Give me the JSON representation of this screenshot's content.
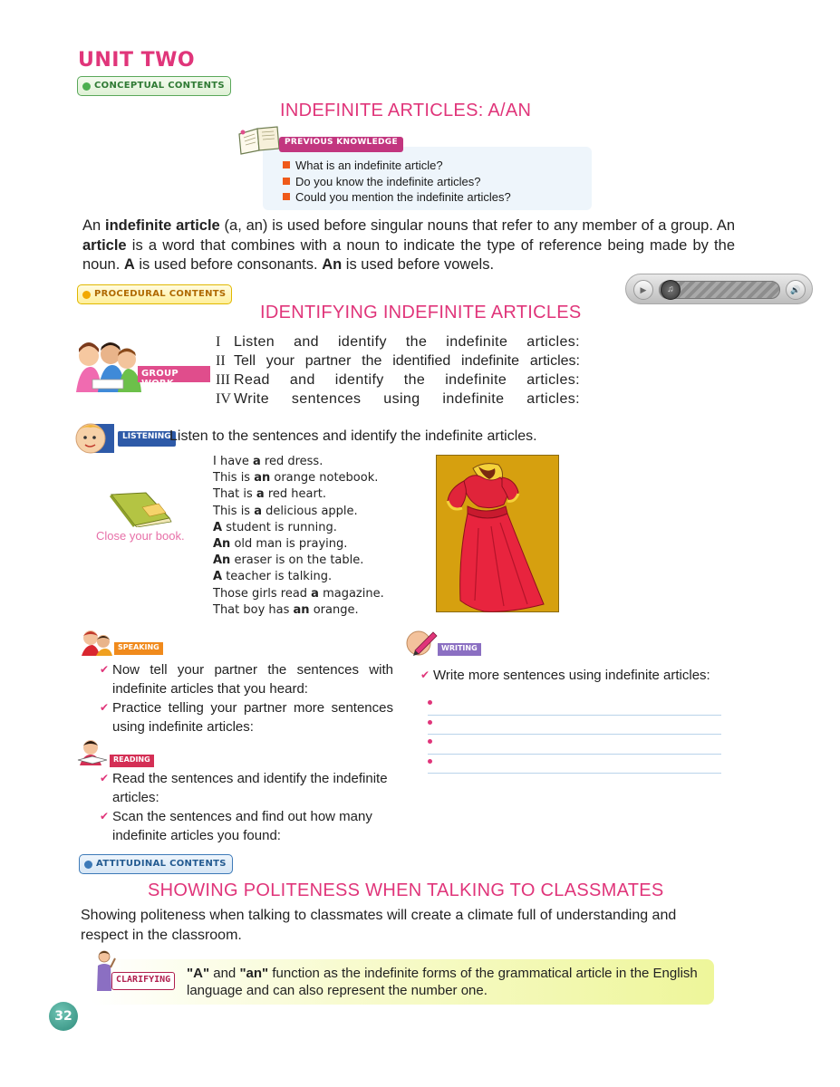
{
  "unit_title": "UNIT TWO",
  "tags": {
    "conceptual": "CONCEPTUAL CONTENTS",
    "procedural": "PROCEDURAL CONTENTS",
    "attitudinal": "ATTITUDINAL CONTENTS"
  },
  "conceptual": {
    "heading": "INDEFINITE ARTICLES: A/AN",
    "previous_knowledge_label": "PREVIOUS KNOWLEDGE",
    "questions": [
      "What is an indefinite article?",
      "Do you know the indefinite articles?",
      "Could you mention the indefinite articles?"
    ],
    "intro": {
      "s1": "An ",
      "s2": "indefinite article",
      "s3": " (a, an) is used before singular nouns that refer to any member of a group. An ",
      "s4": "article",
      "s5": " is a word that combines with a noun to indicate the type of reference being made by the noun. ",
      "s6": "A",
      "s7": " is used before consonants. ",
      "s8": "An",
      "s9": " is used before vowels."
    }
  },
  "procedural": {
    "heading": "IDENTIFYING INDEFINITE ARTICLES",
    "group_work_label": "GROUP WORK",
    "steps": [
      {
        "num": "I",
        "text": "Listen and identify the indefinite articles:"
      },
      {
        "num": "II",
        "text": "Tell your partner the identified indefinite articles:"
      },
      {
        "num": "III",
        "text": "Read and identify the indefinite articles:"
      },
      {
        "num": "IV",
        "text": "Write sentences using indefinite articles:"
      }
    ],
    "listening_label": "LISTENING",
    "listening_text": "Listen to the sentences and identify the indefinite articles.",
    "close_book": "Close your book.",
    "sentences": [
      {
        "a": "I have ",
        "b": "a",
        "c": " red dress."
      },
      {
        "a": "This is ",
        "b": "an",
        "c": " orange notebook."
      },
      {
        "a": "That is ",
        "b": "a",
        "c": " red heart."
      },
      {
        "a": "This is ",
        "b": "a",
        "c": " delicious apple."
      },
      {
        "a": "",
        "b": "A",
        "c": " student is running."
      },
      {
        "a": "",
        "b": "An",
        "c": " old man is praying."
      },
      {
        "a": "",
        "b": "An",
        "c": " eraser is on the table."
      },
      {
        "a": "",
        "b": "A",
        "c": " teacher is talking."
      },
      {
        "a": "Those girls read ",
        "b": "a",
        "c": " magazine."
      },
      {
        "a": "That boy has ",
        "b": "an",
        "c": " orange."
      }
    ],
    "speaking_label": "SPEAKING",
    "speaking": [
      "Now tell your partner the sentences with indefinite articles that you heard:",
      "Practice telling your partner more sentences using indefinite articles:"
    ],
    "reading_label": "READING",
    "reading": [
      "Read the sentences and identify the indefinite articles:",
      "Scan the sentences and find out how many indefinite articles you found:"
    ],
    "writing_label": "WRITING",
    "writing": "Write more sentences using indefinite articles:"
  },
  "attitudinal": {
    "heading": "SHOWING POLITENESS WHEN TALKING TO CLASSMATES",
    "text": "Showing  politeness when  talking to  classmates will create a climate full of understanding and respect in the classroom.",
    "clarifying_label": "CLARIFYING",
    "clarify": {
      "q1": "\"A\"",
      "m1": " and ",
      "q2": "\"an\"",
      "m2": " function as the indefinite forms of the grammatical article in the English language and can also represent the number one."
    }
  },
  "page_number": "32",
  "colors": {
    "heading_pink": "#e0357a",
    "bullet_orange": "#ef5a1a",
    "page_num_teal": "#2f8c7c"
  },
  "icons": [
    "open-book-icon",
    "play-icon",
    "volume-icon",
    "closed-book-icon",
    "check-icon"
  ]
}
